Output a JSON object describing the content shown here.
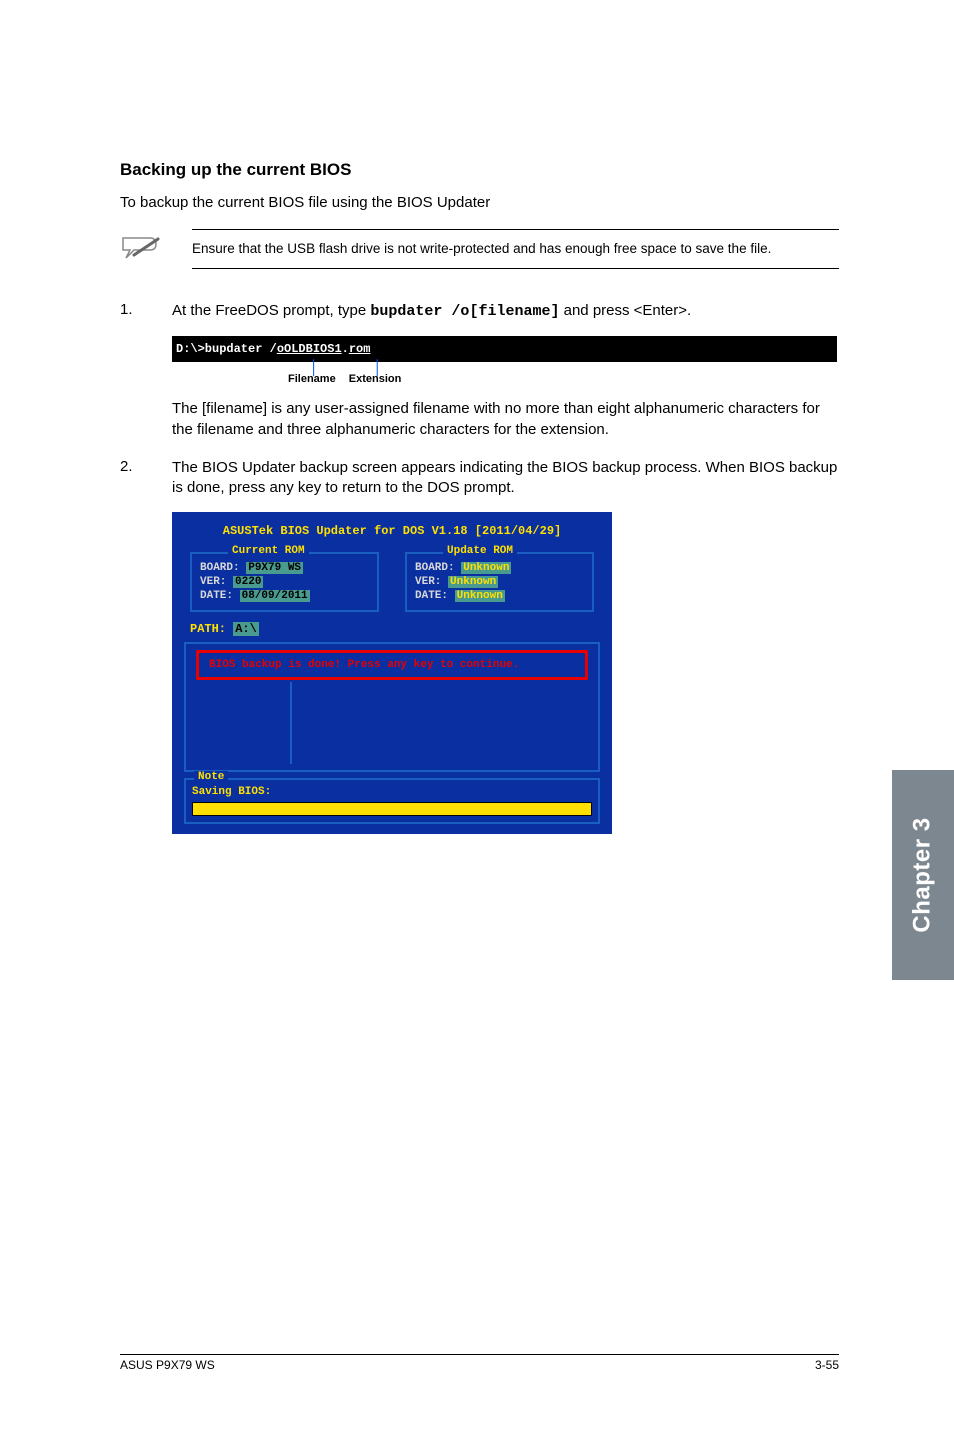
{
  "section_title": "Backing up the current BIOS",
  "intro": "To backup the current BIOS file using the BIOS Updater",
  "note": "Ensure that the USB flash drive is not write-protected and has enough free space to save the file.",
  "step1": {
    "num": "1.",
    "text_a": "At the FreeDOS prompt, type ",
    "cmd": "bupdater /o[filename]",
    "text_b": " and press <Enter>.",
    "cmdline_prefix": "D:\\>bupdater /",
    "cmdline_file": "oOLDBIOS1",
    "cmdline_dot": ".",
    "cmdline_ext": "rom",
    "callout_filename": "Filename",
    "callout_extension": "Extension",
    "sub": "The [filename] is any user-assigned filename with no more than eight alphanumeric characters for the filename and three alphanumeric characters for the extension."
  },
  "step2": {
    "num": "2.",
    "text": "The BIOS Updater backup screen appears indicating the BIOS backup process. When BIOS backup is done, press any key to return to the DOS prompt."
  },
  "bios": {
    "title": "ASUSTek BIOS Updater for DOS V1.18 [2011/04/29]",
    "current_legend": "Current ROM",
    "update_legend": "Update ROM",
    "current": {
      "board_label": "BOARD:",
      "board_val": "P9X79 WS",
      "ver_label": "VER:",
      "ver_val": "0220",
      "date_label": "DATE:",
      "date_val": "08/09/2011"
    },
    "update": {
      "board_label": "BOARD:",
      "board_val": "Unknown",
      "ver_label": "VER:",
      "ver_val": "Unknown",
      "date_label": "DATE:",
      "date_val": "Unknown"
    },
    "path_label": "PATH:",
    "path_val": "A:\\",
    "message": "BIOS backup is done! Press any key to continue.",
    "note_legend": "Note",
    "saving": "Saving BIOS:"
  },
  "sidebar": "Chapter 3",
  "footer_left": "ASUS P9X79 WS",
  "footer_right": "3-55"
}
